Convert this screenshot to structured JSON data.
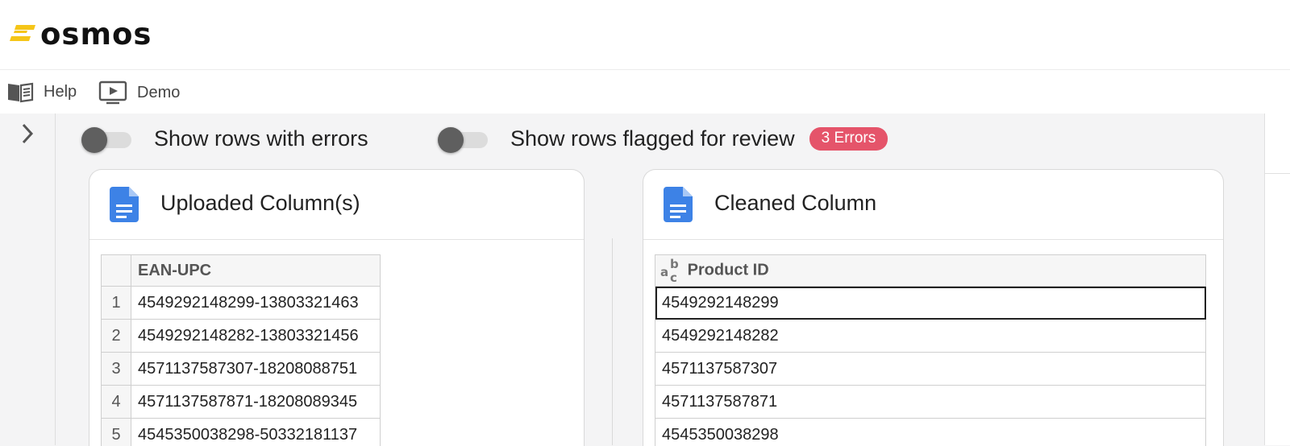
{
  "brand": {
    "name": "osmos",
    "accent": "#f5c518"
  },
  "nav": {
    "help_label": "Help",
    "demo_label": "Demo"
  },
  "filters": {
    "errors_label": "Show rows with errors",
    "flagged_label": "Show rows flagged for review",
    "error_badge": "3 Errors",
    "badge_color": "#e5546a"
  },
  "uploaded": {
    "title": "Uploaded Column(s)",
    "column_header": "EAN-UPC",
    "rows": [
      {
        "index": "1",
        "value": "4549292148299-13803321463"
      },
      {
        "index": "2",
        "value": "4549292148282-13803321456"
      },
      {
        "index": "3",
        "value": "4571137587307-18208088751"
      },
      {
        "index": "4",
        "value": "4571137587871-18208089345"
      },
      {
        "index": "5",
        "value": "4545350038298-50332181137"
      }
    ]
  },
  "cleaned": {
    "title": "Cleaned Column",
    "type_icon": "text-type-icon",
    "column_header": "Product ID",
    "rows": [
      {
        "value": "4549292148299"
      },
      {
        "value": "4549292148282"
      },
      {
        "value": "4571137587307"
      },
      {
        "value": "4571137587871"
      },
      {
        "value": "4545350038298"
      }
    ]
  }
}
